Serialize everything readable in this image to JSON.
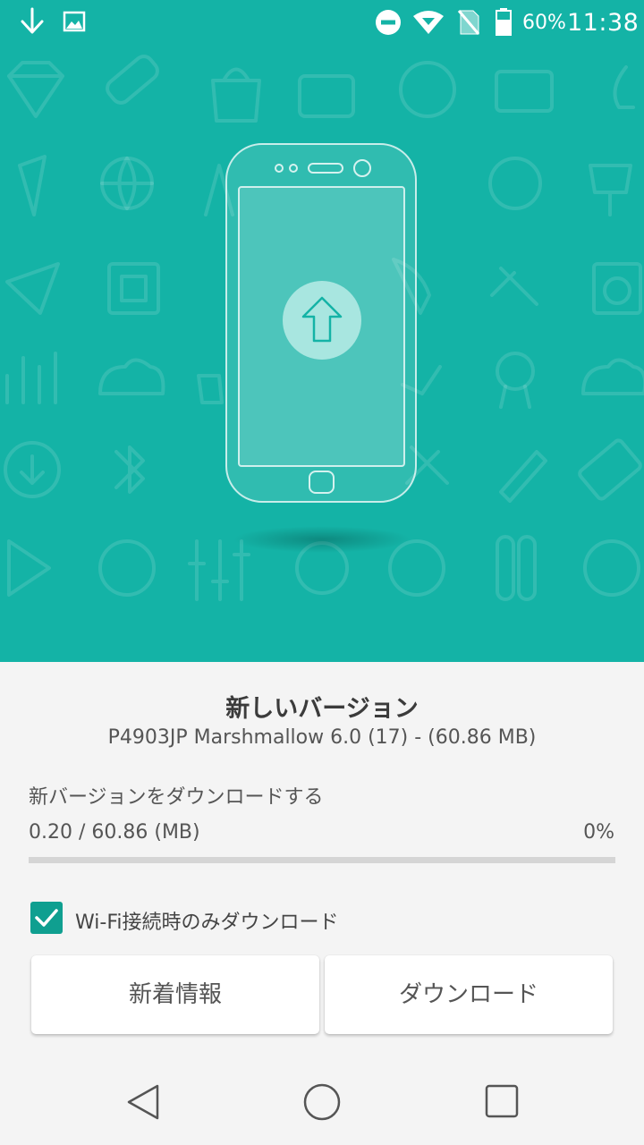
{
  "status_bar": {
    "battery_percent": "60%",
    "time": "11:38",
    "icons": [
      "download-icon",
      "image-icon",
      "do-not-disturb-icon",
      "wifi-icon",
      "no-sim-icon",
      "battery-icon"
    ]
  },
  "update": {
    "title": "新しいバージョン",
    "version_info": "P4903JP Marshmallow 6.0 (17) - (60.86 MB)",
    "download_label": "新バージョンをダウンロードする",
    "progress_text": "0.20 / 60.86 (MB)",
    "progress_percent": "0%",
    "progress_value": 0,
    "wifi_only_label": "Wi-Fi接続時のみダウンロード",
    "wifi_only_checked": true,
    "whats_new_button": "新着情報",
    "download_button": "ダウンロード"
  },
  "colors": {
    "accent": "#14b3a6",
    "checkbox": "#0f9f90",
    "background": "#f4f4f4"
  },
  "nav_bar": {
    "icons": [
      "back-icon",
      "home-icon",
      "recents-icon"
    ]
  }
}
